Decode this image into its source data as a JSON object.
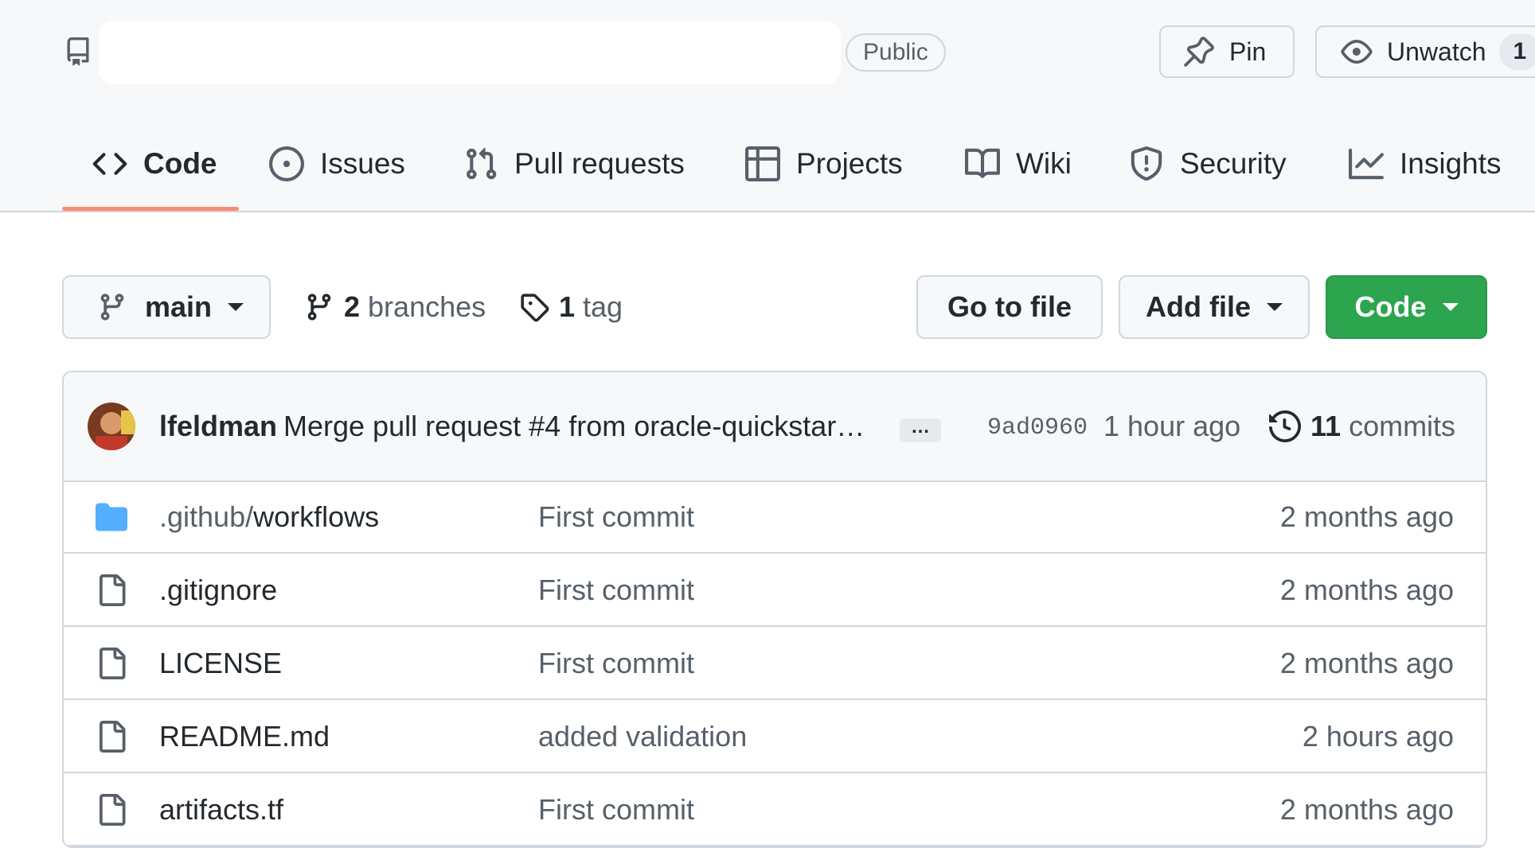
{
  "header": {
    "visibility": "Public",
    "pin_label": "Pin",
    "watch_label": "Unwatch",
    "watch_count": "1"
  },
  "tabs": [
    {
      "label": "Code",
      "icon": "code-icon",
      "active": true
    },
    {
      "label": "Issues",
      "icon": "issue-circle-icon"
    },
    {
      "label": "Pull requests",
      "icon": "pull-request-icon"
    },
    {
      "label": "Projects",
      "icon": "table-icon"
    },
    {
      "label": "Wiki",
      "icon": "book-icon"
    },
    {
      "label": "Security",
      "icon": "shield-icon"
    },
    {
      "label": "Insights",
      "icon": "graph-icon"
    }
  ],
  "toolbar": {
    "branch": "main",
    "branches_count": "2",
    "branches_label": "branches",
    "tags_count": "1",
    "tags_label": "tag",
    "go_to_file": "Go to file",
    "add_file": "Add file",
    "code": "Code"
  },
  "latest_commit": {
    "author": "lfeldman",
    "message": "Merge pull request #4 from oracle-quickstar…",
    "ellipsis": "…",
    "sha": "9ad0960",
    "time": "1 hour ago",
    "commits_count": "11",
    "commits_label": "commits"
  },
  "files": [
    {
      "type": "folder",
      "name_prefix": ".github/",
      "name_main": "workflows",
      "commit": "First commit",
      "age": "2 months ago"
    },
    {
      "type": "file",
      "name_main": ".gitignore",
      "commit": "First commit",
      "age": "2 months ago"
    },
    {
      "type": "file",
      "name_main": "LICENSE",
      "commit": "First commit",
      "age": "2 months ago"
    },
    {
      "type": "file",
      "name_main": "README.md",
      "commit": "added validation",
      "age": "2 hours ago"
    },
    {
      "type": "file",
      "name_main": "artifacts.tf",
      "commit": "First commit",
      "age": "2 months ago"
    }
  ],
  "colors": {
    "accent_underline": "#fd8c73",
    "code_button": "#2da44e",
    "folder": "#54aeff"
  }
}
